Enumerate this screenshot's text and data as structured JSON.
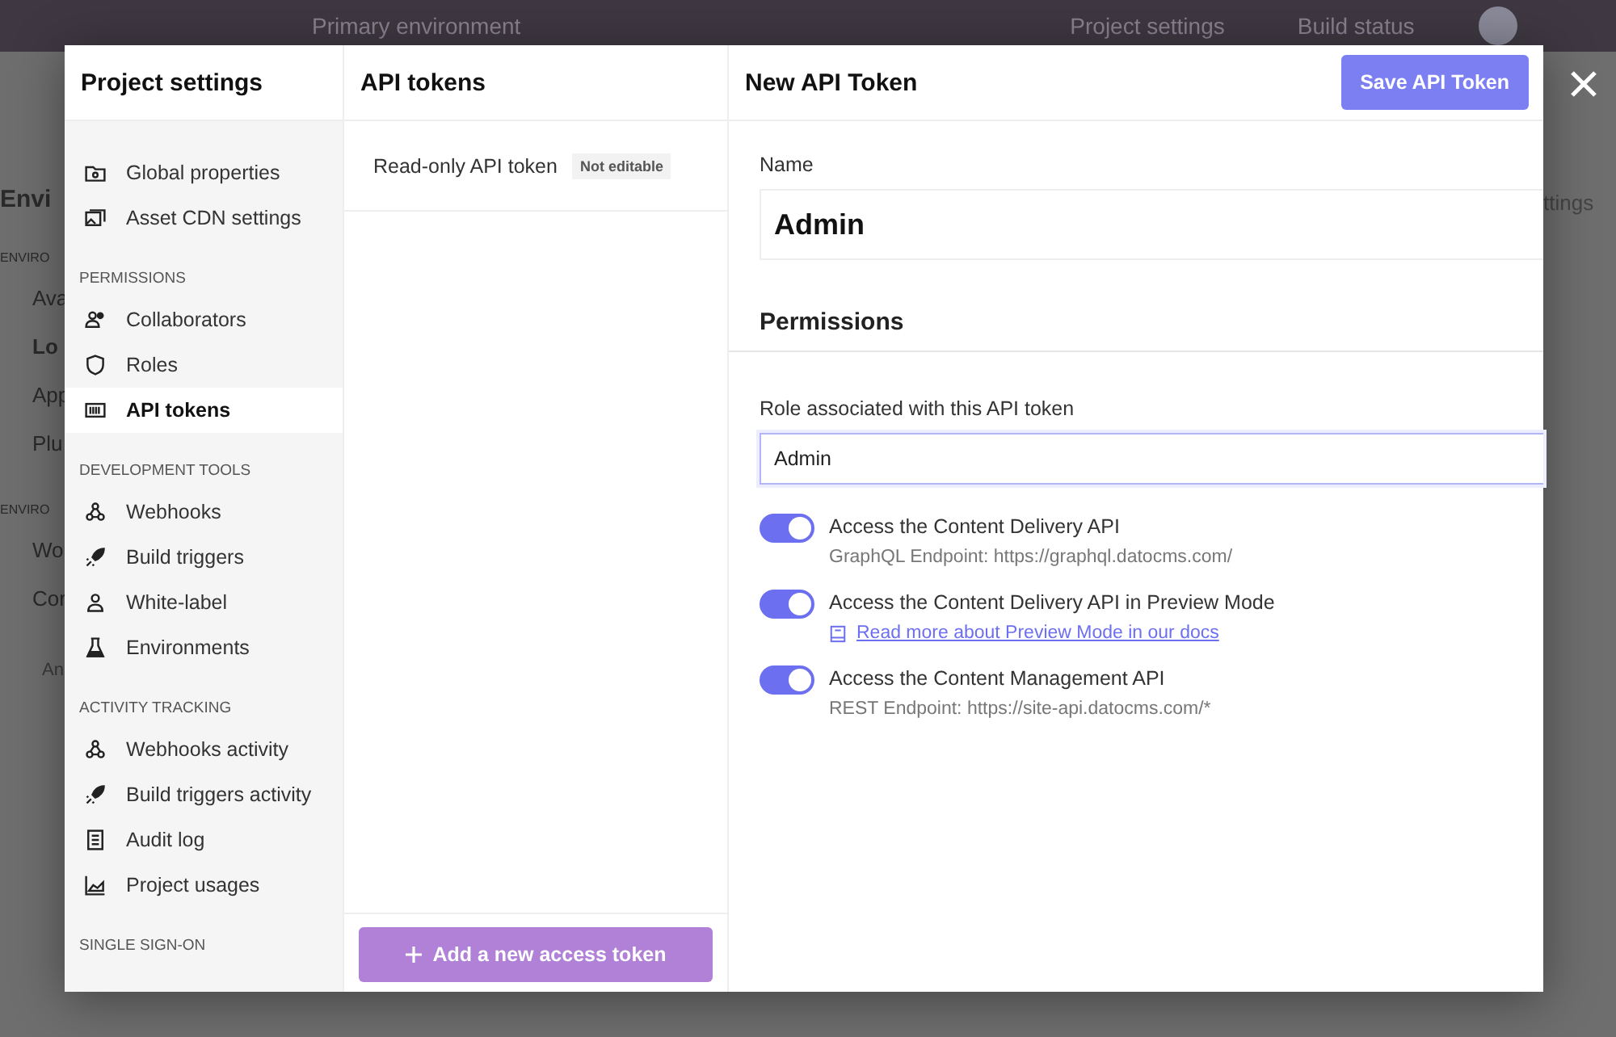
{
  "background": {
    "topbar": {
      "environment": "Primary environment",
      "project_settings": "Project settings",
      "build_status": "Build status"
    },
    "left_fragments": [
      {
        "kind": "heading",
        "text": "Envi"
      },
      {
        "kind": "section",
        "text": "ENVIRO"
      },
      {
        "kind": "item",
        "text": "Ava",
        "selected": false
      },
      {
        "kind": "item",
        "text": "Lo",
        "selected": true
      },
      {
        "kind": "item",
        "text": "App",
        "selected": false
      },
      {
        "kind": "item",
        "text": "Plu",
        "selected": false
      },
      {
        "kind": "section",
        "text": "ENVIRO"
      },
      {
        "kind": "item",
        "text": "Wo",
        "selected": false
      },
      {
        "kind": "item",
        "text": "Cor",
        "selected": false
      },
      {
        "kind": "help",
        "text": "An"
      }
    ],
    "right_fragment": "ttings"
  },
  "modal": {
    "sidebar": {
      "title": "Project settings",
      "groups": [
        {
          "items": [
            {
              "label": "Global properties",
              "kind": "folder",
              "selected": false
            },
            {
              "label": "Asset CDN settings",
              "kind": "images",
              "selected": false
            }
          ]
        },
        {
          "heading": "PERMISSIONS",
          "items": [
            {
              "label": "Collaborators",
              "kind": "users",
              "selected": false
            },
            {
              "label": "Roles",
              "kind": "shield",
              "selected": false
            },
            {
              "label": "API tokens",
              "kind": "barcode",
              "selected": true
            }
          ]
        },
        {
          "heading": "DEVELOPMENT TOOLS",
          "items": [
            {
              "label": "Webhooks",
              "kind": "webhook",
              "selected": false
            },
            {
              "label": "Build triggers",
              "kind": "rocket",
              "selected": false
            },
            {
              "label": "White-label",
              "kind": "user",
              "selected": false
            },
            {
              "label": "Environments",
              "kind": "flask",
              "selected": false
            }
          ]
        },
        {
          "heading": "ACTIVITY TRACKING",
          "items": [
            {
              "label": "Webhooks activity",
              "kind": "webhook",
              "selected": false
            },
            {
              "label": "Build triggers activity",
              "kind": "rocket",
              "selected": false
            },
            {
              "label": "Audit log",
              "kind": "log",
              "selected": false
            },
            {
              "label": "Project usages",
              "kind": "chart",
              "selected": false
            }
          ]
        },
        {
          "heading": "SINGLE SIGN-ON"
        }
      ]
    },
    "tokens": {
      "title": "API tokens",
      "items": [
        {
          "label": "Read-only API token",
          "badge": "Not editable"
        }
      ],
      "add_button": "Add a new access token"
    },
    "form": {
      "title": "New API Token",
      "save_button": "Save API Token",
      "name_label": "Name",
      "name_value": "Admin",
      "section": "Permissions",
      "role_label": "Role associated with this API token",
      "role_value": "Admin",
      "permissions": [
        {
          "label": "Access the Content Delivery API",
          "on": true,
          "kind": "note",
          "note": "GraphQL Endpoint: https://graphql.datocms.com/"
        },
        {
          "label": "Access the Content Delivery API in Preview Mode",
          "on": true,
          "kind": "link",
          "note": "Read more about Preview Mode in our docs"
        },
        {
          "label": "Access the Content Management API",
          "on": true,
          "kind": "note",
          "note": "REST Endpoint: https://site-api.datocms.com/*"
        }
      ]
    }
  }
}
